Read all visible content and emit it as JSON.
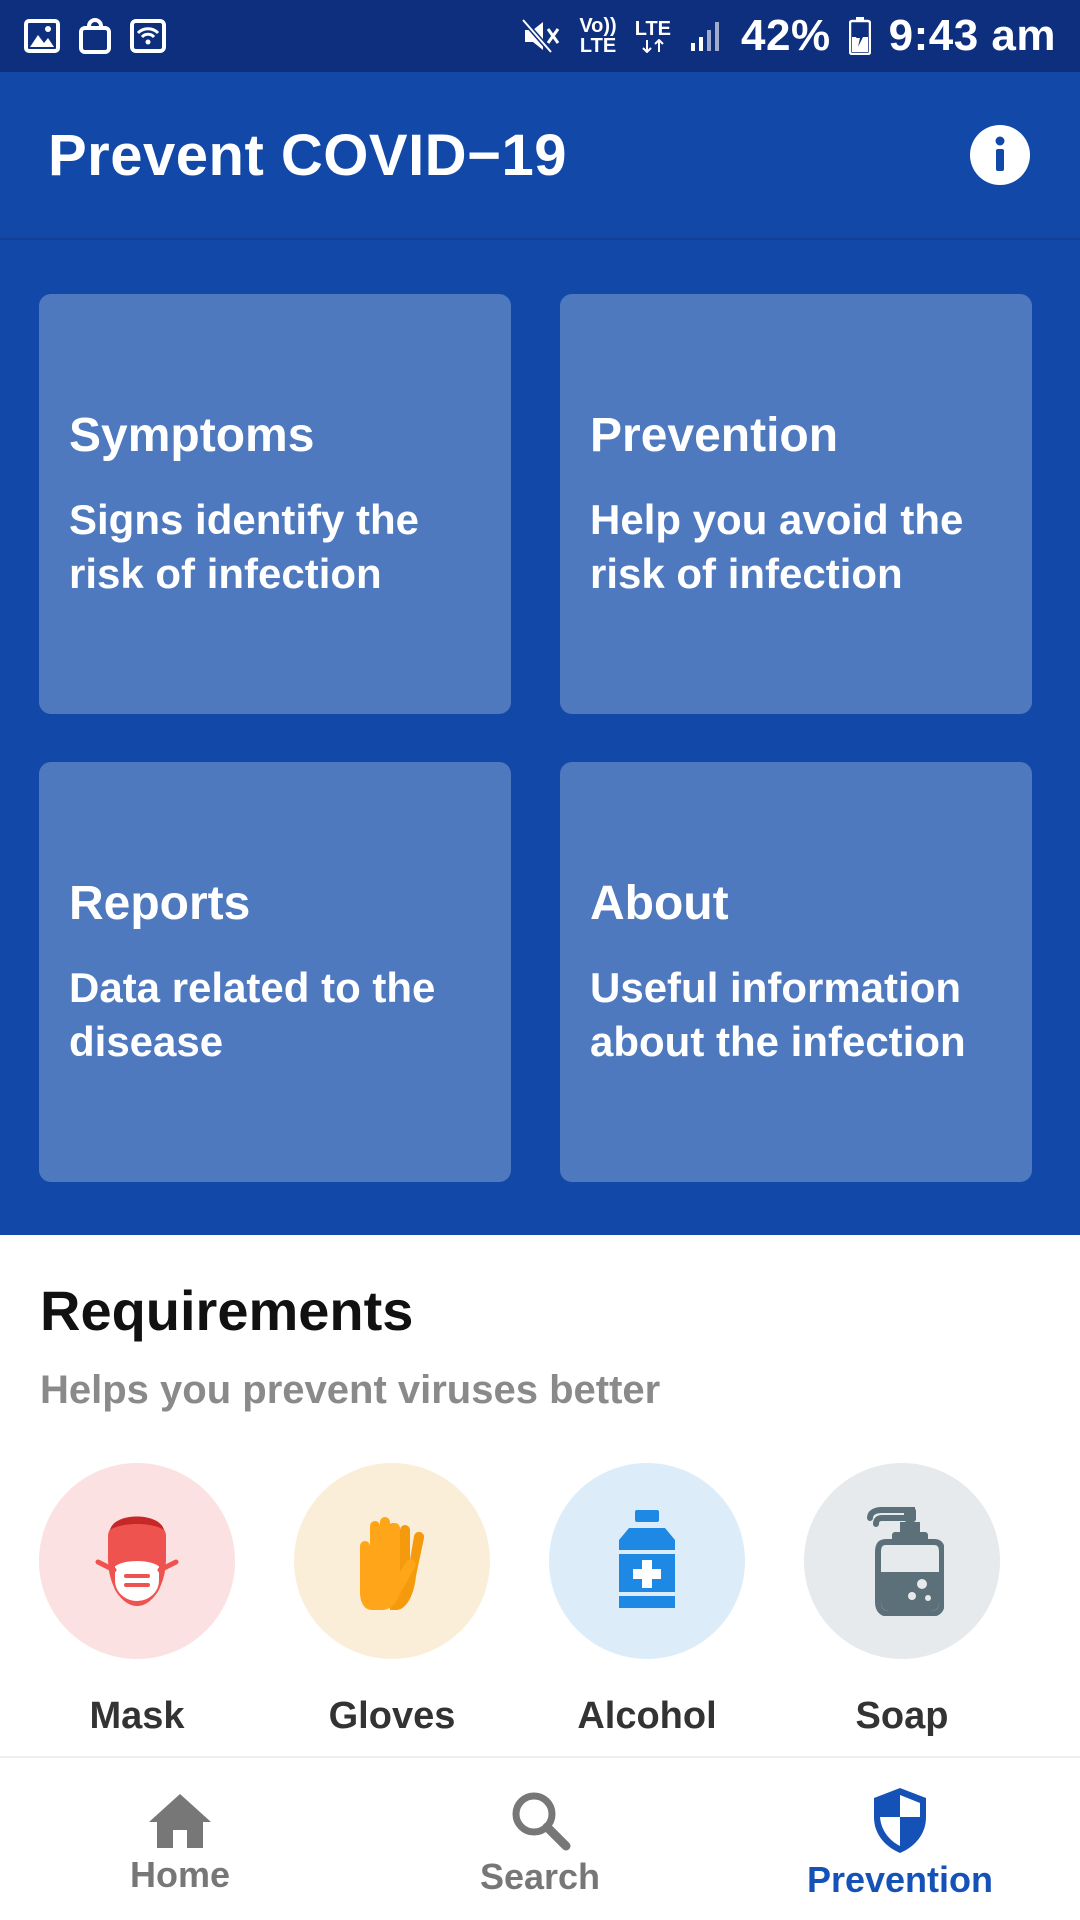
{
  "status_bar": {
    "battery": "42%",
    "time": "9:43 am",
    "volte_label_top": "Vo))",
    "volte_label_bottom": "LTE",
    "lte_label": "LTE",
    "icons": [
      "gallery-icon",
      "shopping-bag-icon",
      "wifi-icon",
      "mute-icon",
      "volte-icon",
      "lte-icon",
      "signal-icon",
      "battery-charging-icon"
    ]
  },
  "app_bar": {
    "title": "Prevent COVID−19",
    "info_icon": "info-icon"
  },
  "cards": [
    {
      "title": "Symptoms",
      "description": "Signs identify the risk of infection"
    },
    {
      "title": "Prevention",
      "description": "Help you avoid the risk of infection"
    },
    {
      "title": "Reports",
      "description": "Data related to the disease"
    },
    {
      "title": "About",
      "description": "Useful information about the infection"
    }
  ],
  "requirements": {
    "title": "Requirements",
    "subtitle": "Helps you prevent viruses better",
    "items": [
      {
        "label": "Mask",
        "icon": "mask-icon",
        "bg": "#fbe1e1",
        "color": "#ef5350"
      },
      {
        "label": "Gloves",
        "icon": "gloves-icon",
        "bg": "#fbeed9",
        "color": "#ffa51a"
      },
      {
        "label": "Alcohol",
        "icon": "alcohol-bottle-icon",
        "bg": "#dcedf9",
        "color": "#1e88e5"
      },
      {
        "label": "Soap",
        "icon": "soap-dispenser-icon",
        "bg": "#e6eaec",
        "color": "#5b7079"
      }
    ]
  },
  "bottom_nav": {
    "items": [
      {
        "label": "Home",
        "icon": "home-icon",
        "active": false
      },
      {
        "label": "Search",
        "icon": "search-icon",
        "active": false
      },
      {
        "label": "Prevention",
        "icon": "shield-icon",
        "active": true
      }
    ]
  },
  "colors": {
    "status_bar": "#0d2f7e",
    "primary": "#1249a8",
    "card": "#4f79bf",
    "accent": "#1552b8"
  }
}
